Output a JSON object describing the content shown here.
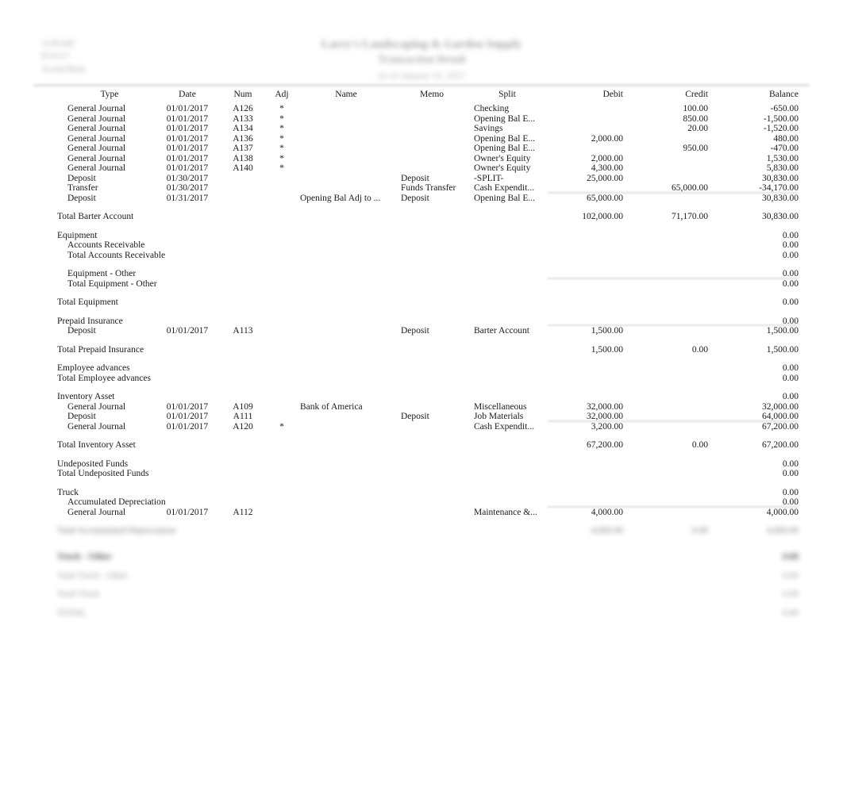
{
  "report": {
    "stamp_date": "11:49 AM",
    "stamp_time": "07/31/17",
    "stamp_basis": "Accrual Basis",
    "company": "Larry's Landscaping & Garden Supply",
    "title": "Transaction Detail",
    "period": "As of January 31, 2017"
  },
  "columns": {
    "type": "Type",
    "date": "Date",
    "num": "Num",
    "adj": "Adj",
    "name": "Name",
    "memo": "Memo",
    "split": "Split",
    "debit": "Debit",
    "credit": "Credit",
    "balance": "Balance"
  },
  "rows": [
    {
      "kind": "detail",
      "level": 1,
      "type": "General Journal",
      "date": "01/01/2017",
      "num": "A126",
      "adj": "*",
      "name": "",
      "memo": "",
      "split": "Checking",
      "debit": "",
      "credit": "100.00",
      "balance": "-650.00"
    },
    {
      "kind": "detail",
      "level": 1,
      "type": "General Journal",
      "date": "01/01/2017",
      "num": "A133",
      "adj": "*",
      "name": "",
      "memo": "",
      "split": "Opening Bal E...",
      "debit": "",
      "credit": "850.00",
      "balance": "-1,500.00"
    },
    {
      "kind": "detail",
      "level": 1,
      "type": "General Journal",
      "date": "01/01/2017",
      "num": "A134",
      "adj": "*",
      "name": "",
      "memo": "",
      "split": "Savings",
      "debit": "",
      "credit": "20.00",
      "balance": "-1,520.00"
    },
    {
      "kind": "detail",
      "level": 1,
      "type": "General Journal",
      "date": "01/01/2017",
      "num": "A136",
      "adj": "*",
      "name": "",
      "memo": "",
      "split": "Opening Bal E...",
      "debit": "2,000.00",
      "credit": "",
      "balance": "480.00"
    },
    {
      "kind": "detail",
      "level": 1,
      "type": "General Journal",
      "date": "01/01/2017",
      "num": "A137",
      "adj": "*",
      "name": "",
      "memo": "",
      "split": "Opening Bal E...",
      "debit": "",
      "credit": "950.00",
      "balance": "-470.00"
    },
    {
      "kind": "detail",
      "level": 1,
      "type": "General Journal",
      "date": "01/01/2017",
      "num": "A138",
      "adj": "*",
      "name": "",
      "memo": "",
      "split": "Owner's Equity",
      "debit": "2,000.00",
      "credit": "",
      "balance": "1,530.00"
    },
    {
      "kind": "detail",
      "level": 1,
      "type": "General Journal",
      "date": "01/01/2017",
      "num": "A140",
      "adj": "*",
      "name": "",
      "memo": "",
      "split": "Owner's Equity",
      "debit": "4,300.00",
      "credit": "",
      "balance": "5,830.00"
    },
    {
      "kind": "detail",
      "level": 1,
      "type": "Deposit",
      "date": "01/30/2017",
      "num": "",
      "adj": "",
      "name": "",
      "memo": "Deposit",
      "split": "-SPLIT-",
      "debit": "25,000.00",
      "credit": "",
      "balance": "30,830.00"
    },
    {
      "kind": "detail",
      "level": 1,
      "type": "Transfer",
      "date": "01/30/2017",
      "num": "",
      "adj": "",
      "name": "",
      "memo": "Funds Transfer",
      "split": "Cash Expendit...",
      "debit": "",
      "credit": "65,000.00",
      "balance": "-34,170.00"
    },
    {
      "kind": "detail",
      "level": 1,
      "type": "Deposit",
      "date": "01/31/2017",
      "num": "",
      "adj": "",
      "name": "Opening Bal Adj to ...",
      "memo": "Deposit",
      "split": "Opening Bal E...",
      "debit": "65,000.00",
      "credit": "",
      "balance": "30,830.00",
      "rule": "full"
    },
    {
      "kind": "spacer"
    },
    {
      "kind": "total",
      "level": 0,
      "type": "Total Barter Account",
      "debit": "102,000.00",
      "credit": "71,170.00",
      "balance": "30,830.00"
    },
    {
      "kind": "spacer"
    },
    {
      "kind": "head",
      "level": 0,
      "type": "Equipment",
      "balance": "0.00"
    },
    {
      "kind": "head",
      "level": 1,
      "type": "Accounts Receivable",
      "balance": "0.00"
    },
    {
      "kind": "total",
      "level": 1,
      "type": "Total Accounts Receivable",
      "balance": "0.00"
    },
    {
      "kind": "spacer"
    },
    {
      "kind": "head",
      "level": 1,
      "type": "Equipment - Other",
      "balance": "0.00"
    },
    {
      "kind": "total",
      "level": 1,
      "type": "Total Equipment - Other",
      "balance": "0.00",
      "rule": "full"
    },
    {
      "kind": "spacer"
    },
    {
      "kind": "total",
      "level": 0,
      "type": "Total Equipment",
      "balance": "0.00"
    },
    {
      "kind": "spacer"
    },
    {
      "kind": "head",
      "level": 0,
      "type": "Prepaid Insurance",
      "balance": "0.00"
    },
    {
      "kind": "detail",
      "level": 1,
      "type": "Deposit",
      "date": "01/01/2017",
      "num": "A113",
      "adj": "",
      "name": "",
      "memo": "Deposit",
      "split": "Barter Account",
      "debit": "1,500.00",
      "credit": "",
      "balance": "1,500.00",
      "rule": "full"
    },
    {
      "kind": "spacer"
    },
    {
      "kind": "total",
      "level": 0,
      "type": "Total Prepaid Insurance",
      "debit": "1,500.00",
      "credit": "0.00",
      "balance": "1,500.00"
    },
    {
      "kind": "spacer"
    },
    {
      "kind": "head",
      "level": 0,
      "type": "Employee advances",
      "balance": "0.00"
    },
    {
      "kind": "total",
      "level": 0,
      "type": "Total Employee advances",
      "balance": "0.00"
    },
    {
      "kind": "spacer"
    },
    {
      "kind": "head",
      "level": 0,
      "type": "Inventory Asset",
      "balance": "0.00"
    },
    {
      "kind": "detail",
      "level": 1,
      "type": "General Journal",
      "date": "01/01/2017",
      "num": "A109",
      "adj": "",
      "name": "Bank of America",
      "memo": "",
      "split": "Miscellaneous",
      "debit": "32,000.00",
      "credit": "",
      "balance": "32,000.00"
    },
    {
      "kind": "detail",
      "level": 1,
      "type": "Deposit",
      "date": "01/01/2017",
      "num": "A111",
      "adj": "",
      "name": "",
      "memo": "Deposit",
      "split": "Job Materials",
      "debit": "32,000.00",
      "credit": "",
      "balance": "64,000.00"
    },
    {
      "kind": "detail",
      "level": 1,
      "type": "General Journal",
      "date": "01/01/2017",
      "num": "A120",
      "adj": "*",
      "name": "",
      "memo": "",
      "split": "Cash Expendit...",
      "debit": "3,200.00",
      "credit": "",
      "balance": "67,200.00",
      "rule": "full"
    },
    {
      "kind": "spacer"
    },
    {
      "kind": "total",
      "level": 0,
      "type": "Total Inventory Asset",
      "debit": "67,200.00",
      "credit": "0.00",
      "balance": "67,200.00"
    },
    {
      "kind": "spacer"
    },
    {
      "kind": "head",
      "level": 0,
      "type": "Undeposited Funds",
      "balance": "0.00"
    },
    {
      "kind": "total",
      "level": 0,
      "type": "Total Undeposited Funds",
      "balance": "0.00"
    },
    {
      "kind": "spacer"
    },
    {
      "kind": "head",
      "level": 0,
      "type": "Truck",
      "balance": "0.00"
    },
    {
      "kind": "head",
      "level": 1,
      "type": "Accumulated Depreciation",
      "balance": "0.00"
    },
    {
      "kind": "detail",
      "level": 1,
      "type": "General Journal",
      "date": "01/01/2017",
      "num": "A112",
      "adj": "",
      "name": "",
      "memo": "",
      "split": "Maintenance &...",
      "debit": "4,000.00",
      "credit": "",
      "balance": "4,000.00",
      "rule": "full"
    }
  ],
  "redacted_rows": [
    {
      "style": "redacted",
      "type": "Total Accumulated Depreciation",
      "debit": "4,000.00",
      "credit": "0.00",
      "balance": "4,000.00"
    },
    {
      "style": "redacted-strong",
      "type": "Truck - Other",
      "balance": "0.00"
    },
    {
      "style": "redacted-light",
      "type": "Total Truck - Other",
      "balance": "0.00"
    },
    {
      "style": "redacted-light",
      "type": "Total Truck",
      "balance": "0.00"
    },
    {
      "style": "redacted-grand",
      "type": "TOTAL",
      "balance": "0.00"
    }
  ]
}
